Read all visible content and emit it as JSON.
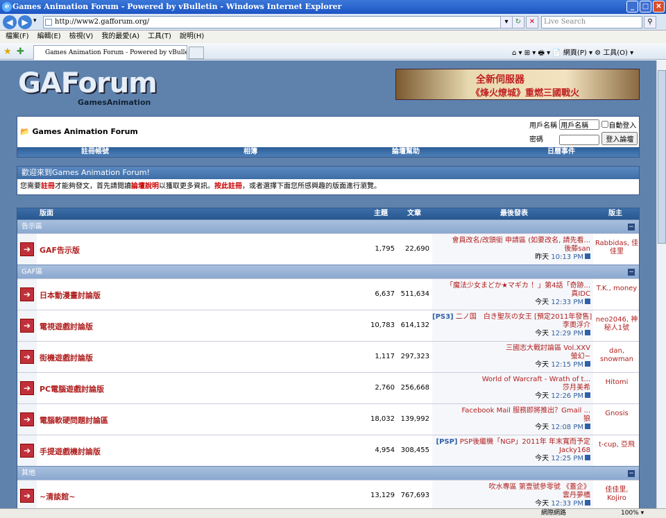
{
  "window": {
    "title": "Games Animation Forum - Powered by vBulletin - Windows Internet Explorer"
  },
  "browser": {
    "url": "http://www2.gafforum.org/",
    "search_placeholder": "Live Search",
    "tab_title": "Games Animation Forum - Powered by vBulletin",
    "menu": [
      "檔案(F)",
      "編輯(E)",
      "檢視(V)",
      "我的最愛(A)",
      "工具(T)",
      "說明(H)"
    ],
    "tools": "⌂ ▾ ⊞ ▾ 🖶 ▾ 📄 網頁(P) ▾ ⚙ 工具(O) ▾"
  },
  "status": {
    "zone": "網際網路",
    "zoom": "100% ▾"
  },
  "site": {
    "logo": "GAForum",
    "logo_sub": "GamesAnimation",
    "banner1": "全新伺服器",
    "banner2": "《烽火燎城》重燃三國戰火"
  },
  "header": {
    "crumb": "Games Animation Forum",
    "user_label": "用戶名稱",
    "user_value": "用戶名稱",
    "remember": "自動登入",
    "pass_label": "密碼",
    "login_btn": "登入論壇"
  },
  "navbar": [
    "註冊帳號",
    "相簿",
    "論壇幫助",
    "日曆事件"
  ],
  "welcome": {
    "title": "歡迎來到Games Animation Forum!",
    "text_a": "您需要",
    "link_reg": "註冊",
    "text_b": "才能夠發文，首先請閱讀",
    "link_help": "論壇說明",
    "text_c": "以獲取更多資訊。",
    "link_reg2": "按此註冊",
    "text_d": "，或者選擇下面您所感興趣的版面進行瀏覽。"
  },
  "table_head": {
    "forum": "版面",
    "threads": "主題",
    "posts": "文章",
    "last": "最後發表",
    "mods": "版主"
  },
  "sections": [
    {
      "name": "告示區",
      "rows": [
        {
          "name": "GAF告示版",
          "threads": "1,795",
          "posts": "22,690",
          "last_title": "會員改名/改頭銜 申請區 (如要改名, 請先看...",
          "last_user": "後藤san",
          "last_day": "昨天",
          "last_time": "10:13 PM",
          "mods": "Rabbidas, 佳佳里"
        }
      ]
    },
    {
      "name": "GAF區",
      "rows": [
        {
          "name": "日本動漫畫討論版",
          "threads": "6,637",
          "posts": "511,634",
          "last_title": "「魔法少女まどか★マギカ ！」第4話「奇跡...",
          "last_user": "真IDC",
          "last_day": "今天",
          "last_time": "12:33 PM",
          "mods": "T.K., money"
        },
        {
          "name": "電視遊戲討論版",
          "threads": "10,783",
          "posts": "614,132",
          "last_tag": "[PS3]",
          "last_title": " 二ノ国　白き聖灰の女王 [預定2011年發售]",
          "last_user": "李奧浮介",
          "last_day": "今天",
          "last_time": "12:29 PM",
          "mods": "neo2046, 神秘人1號"
        },
        {
          "name": "街機遊戲討論版",
          "threads": "1,117",
          "posts": "297,323",
          "last_title": "三國志大戰討論區 Vol.XXV",
          "last_user": "螢幻~",
          "last_day": "今天",
          "last_time": "12:15 PM",
          "mods": "dan, snowman"
        },
        {
          "name": "PC電腦遊戲討論版",
          "threads": "2,760",
          "posts": "256,668",
          "last_title": "World of Warcraft - Wrath of t...",
          "last_user": "莎月美希",
          "last_day": "今天",
          "last_time": "12:26 PM",
          "mods": "Hitomi"
        },
        {
          "name": "電腦軟硬問題討論區",
          "threads": "18,032",
          "posts": "139,992",
          "last_title": "Facebook Mail 服務即將推出？Gmail ...",
          "last_user": "狼",
          "last_day": "今天",
          "last_time": "12:08 PM",
          "mods": "Gnosis"
        },
        {
          "name": "手提遊戲機討論版",
          "threads": "4,954",
          "posts": "308,455",
          "last_tag": "[PSP]",
          "last_title": " PSP後繼機「NGP」2011年 年末寬而予定",
          "last_user": "Jacky168",
          "last_day": "今天",
          "last_time": "12:25 PM",
          "mods": "t-cup, 亞飛"
        }
      ]
    },
    {
      "name": "其他",
      "rows": [
        {
          "name": "~清談館~",
          "threads": "13,129",
          "posts": "767,693",
          "last_title": "吹水專區 第壹號參零號 《蓋企》",
          "last_user": "雲丹夢橋",
          "last_day": "今天",
          "last_time": "12:33 PM",
          "mods": "佳佳里, Kojiro"
        }
      ]
    }
  ]
}
